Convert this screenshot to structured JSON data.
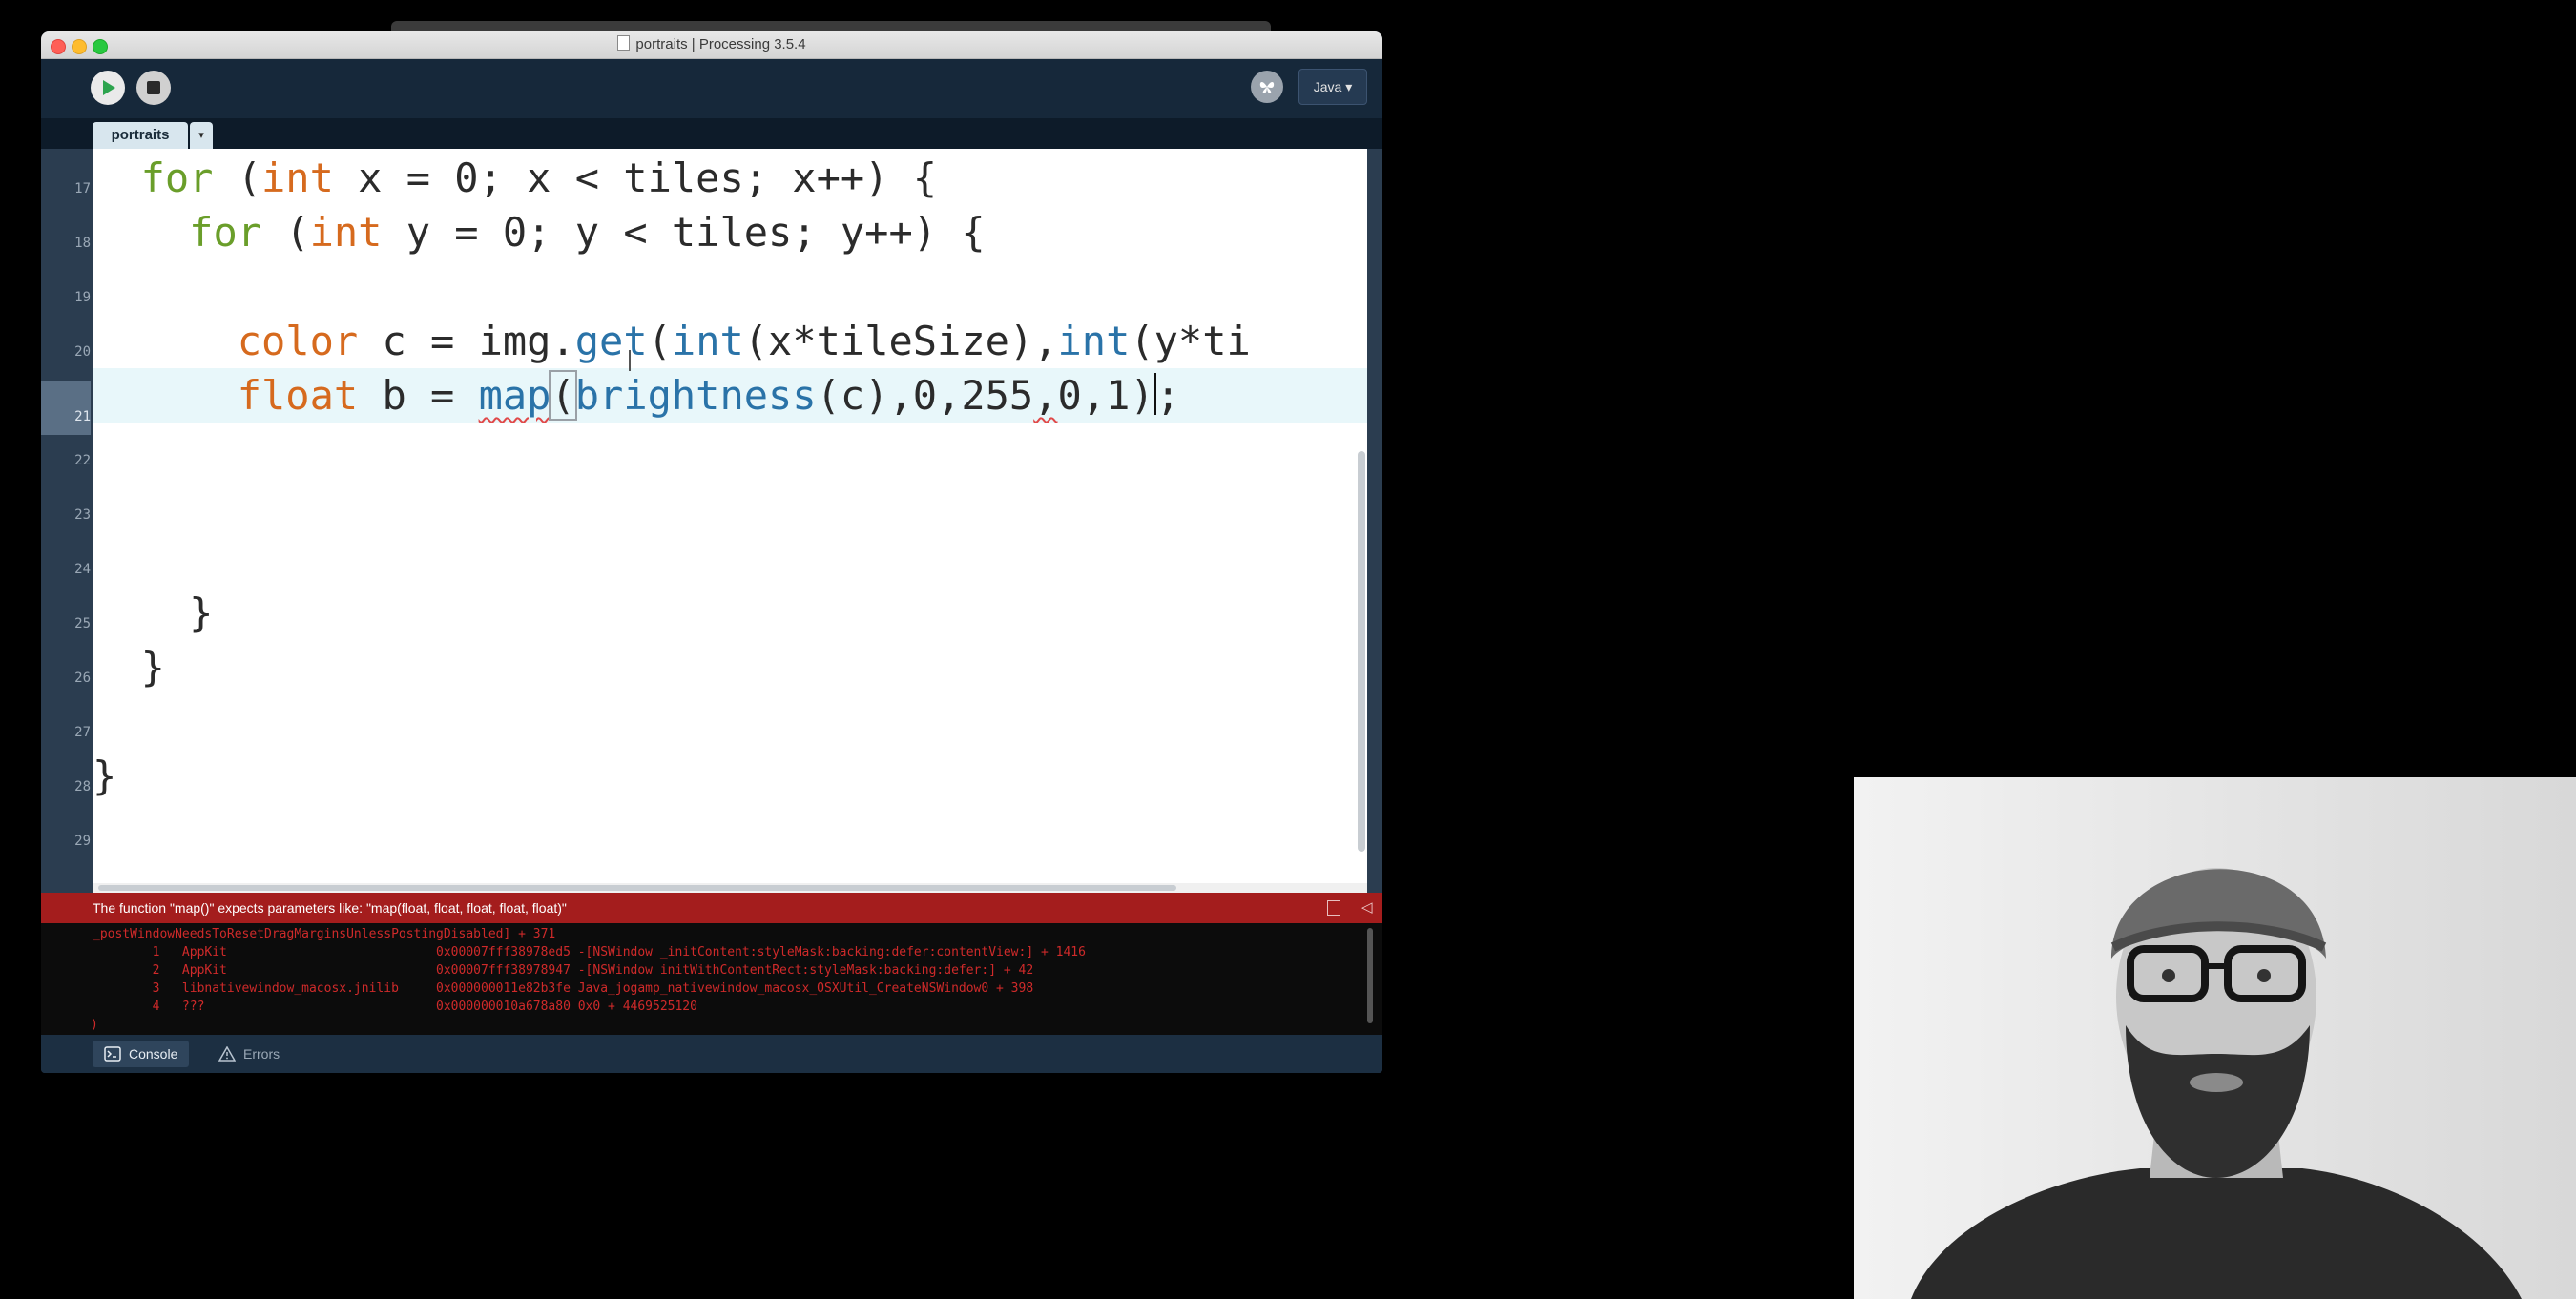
{
  "window": {
    "title": "portraits | Processing 3.5.4"
  },
  "toolbar": {
    "run_icon": "play-icon",
    "stop_icon": "stop-icon",
    "debug_icon": "butterfly-icon",
    "mode_label": "Java ▾"
  },
  "tabs": [
    {
      "label": "portraits"
    }
  ],
  "tab_menu_icon": "▾",
  "line_numbers": [
    "17",
    "18",
    "19",
    "20",
    "21",
    "22",
    "23",
    "24",
    "25",
    "26",
    "27",
    "28",
    "29"
  ],
  "current_line": "21",
  "code": {
    "l17": {
      "kw": "for",
      "p1": " (",
      "ty": "int",
      "rest": " x = 0; x < tiles; x++) {"
    },
    "l18": {
      "kw": "for",
      "p1": " (",
      "ty": "int",
      "rest": " y = 0; y < tiles; y++) {"
    },
    "l20": {
      "ty": "color",
      "p1": " c = im",
      "p1b": "g.",
      "fn1": "get",
      "p2": "(",
      "fn2": "int",
      "p3": "(x*tileSize),",
      "fn3": "int",
      "p4": "(y*ti"
    },
    "l21": {
      "ty": "float",
      "p1": " b = ",
      "fn1": "map",
      "p2": "(",
      "fn2": "brightness",
      "p3": "(c),0,255",
      "p4": ",",
      "p5": "0,1)",
      "p6": ";"
    },
    "l25": "}",
    "l26": "}",
    "l28": "}"
  },
  "error_bar": {
    "message": "The function \"map()\" expects parameters like: \"map(float, float, float, float, float)\""
  },
  "console": {
    "lines": [
      "_postWindowNeedsToResetDragMarginsUnlessPostingDisabled] + 371",
      "        1   AppKit                            0x00007fff38978ed5 -[NSWindow _initContent:styleMask:backing:defer:contentView:] + 1416",
      "        2   AppKit                            0x00007fff38978947 -[NSWindow initWithContentRect:styleMask:backing:defer:] + 42",
      "        3   libnativewindow_macosx.jnilib     0x000000011e82b3fe Java_jogamp_nativewindow_macosx_OSXUtil_CreateNSWindow0 + 398",
      "        4   ???                               0x000000010a678a80 0x0 + 4469525120",
      ")"
    ]
  },
  "footer": {
    "console_label": "Console",
    "errors_label": "Errors"
  }
}
